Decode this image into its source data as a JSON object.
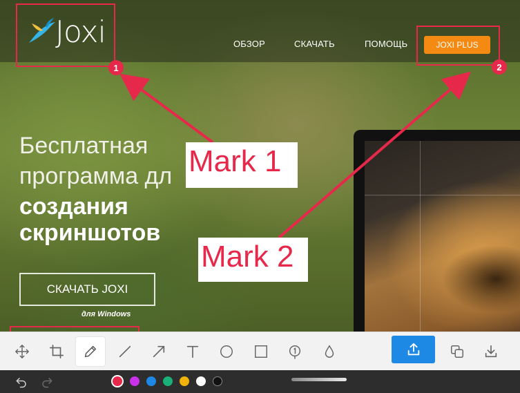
{
  "site": {
    "logo_text": "Joxi",
    "nav": {
      "overview": "ОБЗОР",
      "download": "СКАЧАТЬ",
      "help": "ПОМОЩЬ",
      "plus": "JOXI PLUS"
    },
    "hero": {
      "line1": "Бесплатная",
      "line2": "программа дл",
      "line3": "создания",
      "line4": "скриншотов"
    },
    "download_button": "СКАЧАТЬ JOXI",
    "download_sub": "для Windows"
  },
  "annotations": {
    "badge1": "1",
    "badge2": "2",
    "mark1": "Mark 1",
    "mark2": "Mark 2",
    "color": "#e6294b"
  },
  "toolbar": {
    "tools": [
      "move-icon",
      "crop-icon",
      "pencil-icon",
      "line-icon",
      "arrow-icon",
      "text-icon",
      "ellipse-icon",
      "rectangle-icon",
      "number-icon",
      "blur-drop-icon"
    ],
    "active_tool": "pencil-icon",
    "actions": [
      "upload-icon",
      "copy-icon",
      "save-download-icon"
    ],
    "upload_color": "#1e88e5"
  },
  "palette": {
    "colors": [
      "#e6294b",
      "#c832e8",
      "#1e88e5",
      "#19b07a",
      "#f2b20c",
      "#ffffff",
      "#111111"
    ],
    "selected": "#e6294b"
  },
  "history": [
    "undo-icon",
    "redo-icon"
  ]
}
